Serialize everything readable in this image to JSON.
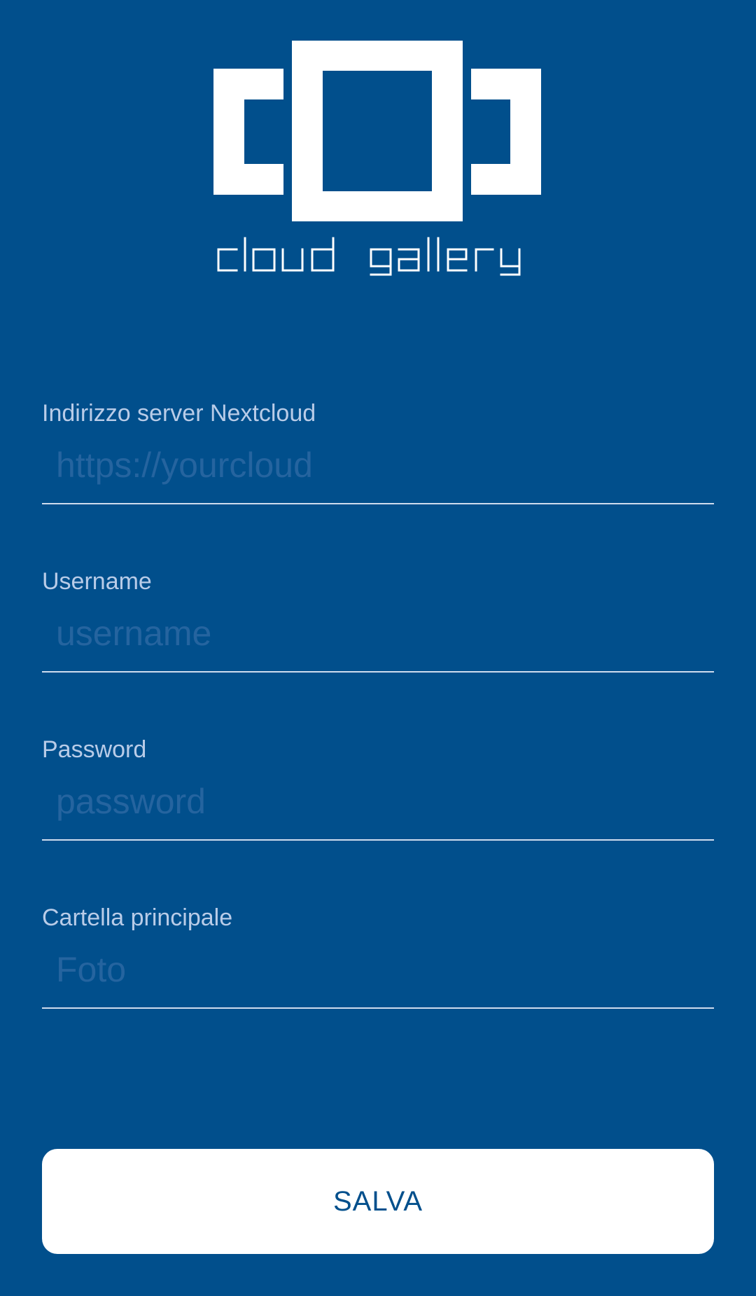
{
  "app": {
    "logo_text": "cloud gallery",
    "colors": {
      "background": "#014f8c",
      "label": "#b9cce8",
      "placeholder": "#25649f",
      "button_background": "#ffffff",
      "button_text": "#014f8c"
    }
  },
  "form": {
    "server": {
      "label": "Indirizzo server Nextcloud",
      "value": "",
      "placeholder": "https://yourcloud"
    },
    "username": {
      "label": "Username",
      "value": "",
      "placeholder": "username"
    },
    "password": {
      "label": "Password",
      "value": "",
      "placeholder": "password"
    },
    "folder": {
      "label": "Cartella principale",
      "value": "",
      "placeholder": "Foto"
    }
  },
  "actions": {
    "save_label": "SALVA"
  }
}
